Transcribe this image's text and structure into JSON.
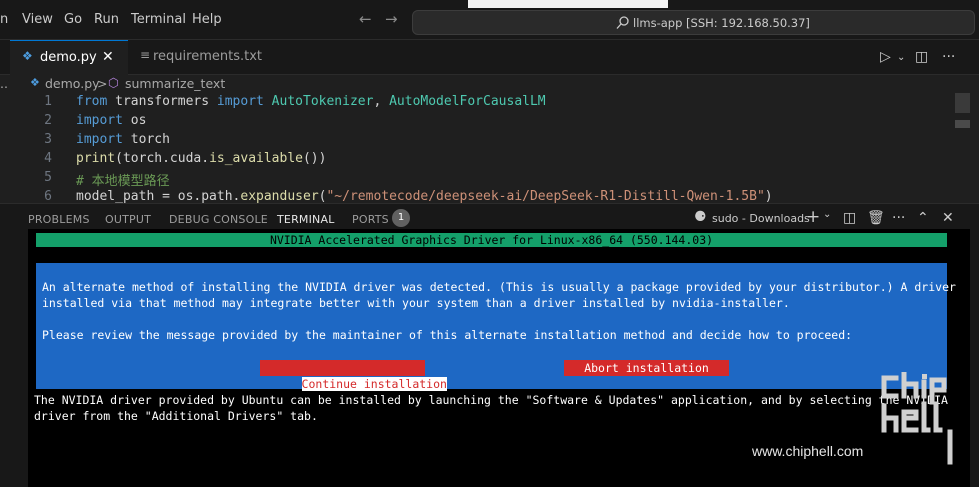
{
  "titlebar": {
    "menu": [
      "n",
      "View",
      "Go",
      "Run",
      "Terminal",
      "Help"
    ],
    "back_icon": "arrow-left-icon",
    "forward_icon": "arrow-right-icon",
    "search_text": "llms-app [SSH: 192.168.50.37]"
  },
  "tabs": [
    {
      "label": "demo.py",
      "active": true,
      "icon": "python-file-icon"
    },
    {
      "label": "requirements.txt",
      "active": false,
      "icon": "text-file-icon"
    }
  ],
  "breadcrumb": {
    "file": "demo.py",
    "separator": ">",
    "symbol": "summarize_text"
  },
  "code_lines": [
    {
      "num": "1",
      "tokens": [
        [
          "kw",
          "from"
        ],
        [
          "txt",
          " transformers "
        ],
        [
          "kw",
          "import"
        ],
        [
          "cls",
          " AutoTokenizer"
        ],
        [
          "txt",
          ", "
        ],
        [
          "cls",
          "AutoModelForCausalLM"
        ]
      ]
    },
    {
      "num": "2",
      "tokens": [
        [
          "kw",
          "import"
        ],
        [
          "txt",
          " os"
        ]
      ]
    },
    {
      "num": "3",
      "tokens": [
        [
          "kw",
          "import"
        ],
        [
          "txt",
          " torch"
        ]
      ]
    },
    {
      "num": "4",
      "tokens": [
        [
          "fn",
          "print"
        ],
        [
          "txt",
          "(torch.cuda."
        ],
        [
          "fn",
          "is_available"
        ],
        [
          "txt",
          "())"
        ]
      ]
    },
    {
      "num": "5",
      "tokens": [
        [
          "cm",
          "# 本地模型路径"
        ]
      ]
    },
    {
      "num": "6",
      "tokens": [
        [
          "txt",
          "model_path = os.path."
        ],
        [
          "fn",
          "expanduser"
        ],
        [
          "txt",
          "("
        ],
        [
          "st",
          "\"~/remotecode/deepseek-ai/DeepSeek-R1-Distill-Qwen-1.5B\""
        ],
        [
          "txt",
          ")"
        ]
      ]
    }
  ],
  "panel": {
    "tabs": [
      "PROBLEMS",
      "OUTPUT",
      "DEBUG CONSOLE",
      "TERMINAL",
      "PORTS"
    ],
    "active_tab": "TERMINAL",
    "ports_count": "1",
    "terminal_name": "sudo - Downloads"
  },
  "terminal": {
    "header": "NVIDIA Accelerated Graphics Driver for Linux-x86_64 (550.144.03)",
    "dialog_lines": [
      "An alternate method of installing the NVIDIA driver was detected. (This is usually a package provided by your distributor.) A driver",
      "installed via that method may integrate better with your system than a driver installed by nvidia-installer.",
      "",
      "Please review the message provided by the maintainer of this alternate installation method and decide how to proceed:"
    ],
    "button_continue": "Continue installation",
    "button_abort": "Abort installation",
    "after_lines": [
      "The NVIDIA driver provided by Ubuntu can be installed by launching the \"Software & Updates\" application, and by selecting the NVIDIA",
      "driver from the \"Additional Drivers\" tab."
    ]
  },
  "watermark": {
    "url": "www.chiphell.com",
    "logo_text": "chip hell"
  },
  "colors": {
    "accent": "#0078d4",
    "terminal_header": "#14a06a",
    "dialog_bg": "#1e68c4",
    "button_red": "#d42a2a"
  }
}
